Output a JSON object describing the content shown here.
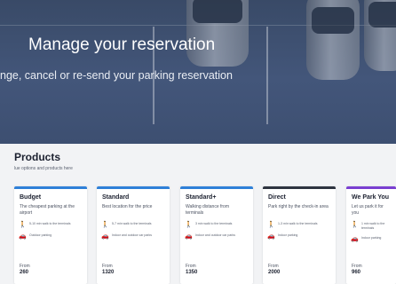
{
  "hero": {
    "title": "Manage your reservation",
    "subtitle": "nge, cancel or re-send your parking reservation"
  },
  "products": {
    "title": "Products",
    "subtitle": "lue options and products here"
  },
  "cards": [
    {
      "name": "Budget",
      "accent": "#2f80d8",
      "description": "The cheapest parking at the airport",
      "feature1": "5-10 min walk to the terminals",
      "feature2": "Outdoor parking",
      "from": "From",
      "price": "260"
    },
    {
      "name": "Standard",
      "accent": "#2f80d8",
      "description": "Best location for the price",
      "feature1": "5-7 min walk to the terminals",
      "feature2": "Indoor and outdoor car parks",
      "from": "From",
      "price": "1320"
    },
    {
      "name": "Standard+",
      "accent": "#2f80d8",
      "description": "Walking distance from terminals",
      "feature1": "3 min walk to the terminals",
      "feature2": "Indoor and outdoor car parks",
      "from": "From",
      "price": "1350"
    },
    {
      "name": "Direct",
      "accent": "#2e3440",
      "description": "Park right by the check-in area",
      "feature1": "1-3 min walk to the terminals",
      "feature2": "Indoor parking",
      "from": "From",
      "price": "2000"
    },
    {
      "name": "We Park You",
      "accent": "#7a3fd1",
      "description": "Let us park it for you",
      "feature1": "1 min walk to the terminals",
      "feature2": "Indoor parking",
      "from": "From",
      "price": "960"
    }
  ]
}
